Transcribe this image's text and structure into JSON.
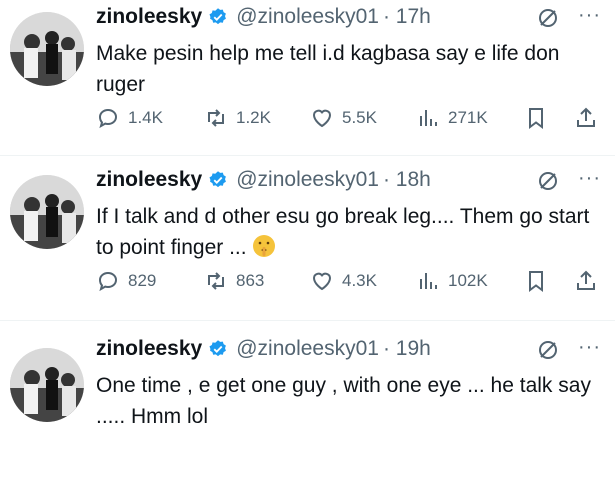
{
  "colors": {
    "verified": "#1d9bf0",
    "muted": "#536471",
    "text": "#0f1419",
    "separator": "#eff3f4"
  },
  "icons": [
    "verified-badge-icon",
    "grok-icon",
    "more-icon",
    "reply-icon",
    "retweet-icon",
    "like-icon",
    "views-icon",
    "bookmark-icon",
    "share-icon"
  ],
  "tweets": [
    {
      "name": "zinoleesky",
      "handle": "@zinoleesky01",
      "time": "· 17h",
      "text": "Make pesin help me tell i.d kagbasa say e life don ruger",
      "replies": "1.4K",
      "retweets": "1.2K",
      "likes": "5.5K",
      "views": "271K"
    },
    {
      "name": "zinoleesky",
      "handle": "@zinoleesky01",
      "time": "· 18h",
      "text": "If I talk and d other esu go break leg.... Them go start to point finger ...",
      "emoji": "shushing-face",
      "replies": "829",
      "retweets": "863",
      "likes": "4.3K",
      "views": "102K"
    },
    {
      "name": "zinoleesky",
      "handle": "@zinoleesky01",
      "time": "· 19h",
      "text": "One time , e get one guy , with one eye ... he talk say ..... Hmm lol"
    }
  ]
}
